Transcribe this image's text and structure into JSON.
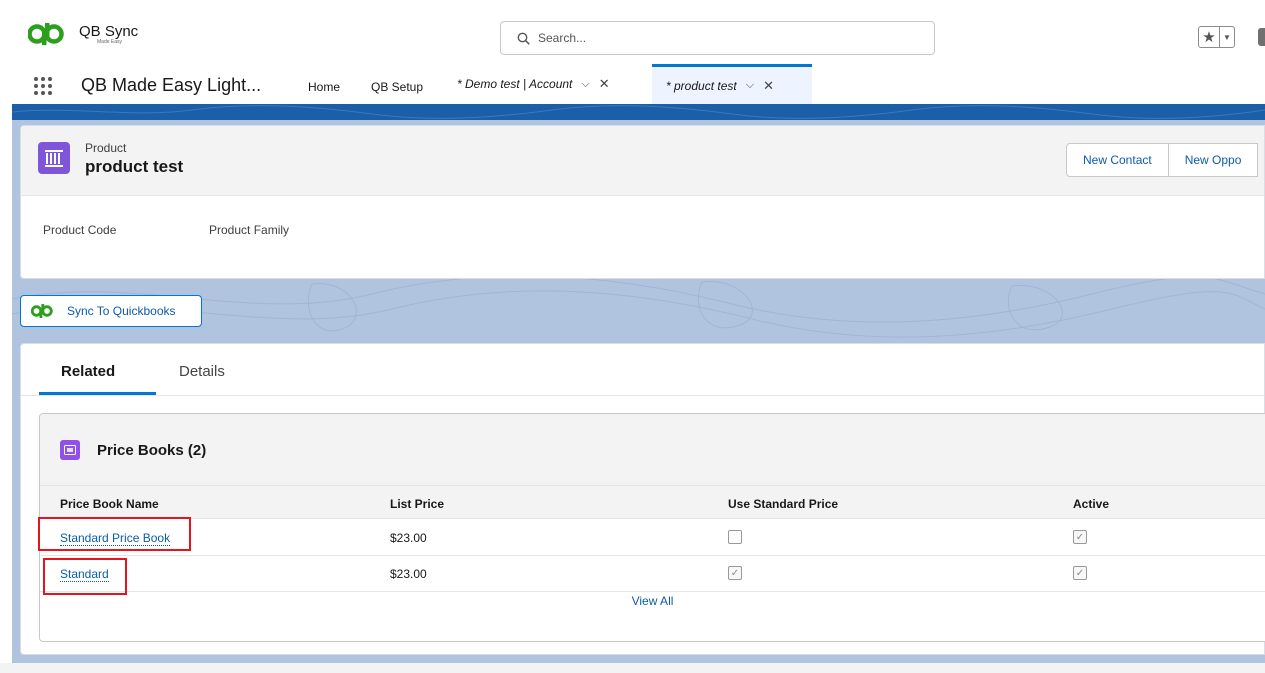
{
  "header": {
    "logo_title": "QB Sync",
    "logo_tagline": "Made Easy",
    "search_placeholder": "Search..."
  },
  "nav": {
    "app_name": "QB Made Easy Light...",
    "items": [
      "Home",
      "QB Setup"
    ],
    "tabs": [
      {
        "label": "* Demo test | Account",
        "active": false
      },
      {
        "label": "* product test",
        "active": true
      }
    ]
  },
  "record": {
    "object_type": "Product",
    "name": "product test",
    "actions": [
      "New Contact",
      "New Oppo"
    ],
    "field_labels": [
      "Product Code",
      "Product Family"
    ]
  },
  "sync_button_label": "Sync To Quickbooks",
  "tabs": [
    "Related",
    "Details"
  ],
  "related_list": {
    "title": "Price Books (2)",
    "columns": [
      "Price Book Name",
      "List Price",
      "Use Standard Price",
      "Active"
    ],
    "rows": [
      {
        "name": "Standard Price Book",
        "list_price": "$23.00",
        "use_standard_price": false,
        "active": true
      },
      {
        "name": "Standard",
        "list_price": "$23.00",
        "use_standard_price": true,
        "active": true
      }
    ],
    "view_all": "View All"
  },
  "colors": {
    "brand_green": "#2ca01c",
    "link_blue": "#0b5cab",
    "accent_blue": "#0176d3",
    "highlight_red": "#e8141c",
    "product_icon_purple": "#7f56d9"
  }
}
